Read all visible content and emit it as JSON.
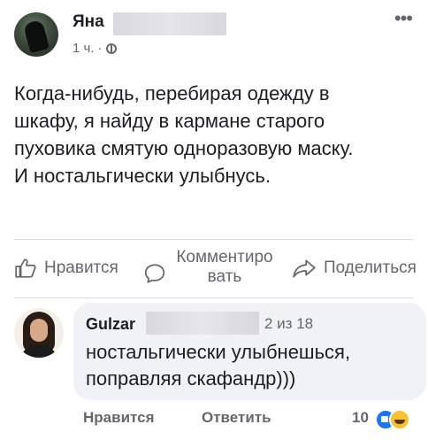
{
  "post": {
    "author_name": "Яна",
    "time": "1 ч.",
    "separator": "·",
    "more_icon": "more-dots-icon",
    "text_lines": [
      "Когда-нибудь, перебирая одежду в",
      "шкафу, я найду в кармане старого",
      "пуховика смятую одноразовую маску.",
      "И ностальгически улыбнусь."
    ]
  },
  "actions": {
    "like_label": "Нравится",
    "comment_label_line1": "Комментиро",
    "comment_label_line2": "вать",
    "share_label": "Поделиться"
  },
  "comment": {
    "author_name": "Gulzar",
    "badge": "2 из 18",
    "text_lines": [
      "ностальгически улыбнешься,",
      "поправляя скафандр)))"
    ],
    "like_label": "Нравится",
    "reply_label": "Ответить",
    "reaction_count": "10",
    "reactions": [
      "like-reaction-icon",
      "haha-reaction-icon"
    ]
  },
  "colors": {
    "text": "#1c1e21",
    "secondary": "#65676b",
    "bubble": "#f0f2f5",
    "like_blue": "#1877f2"
  }
}
